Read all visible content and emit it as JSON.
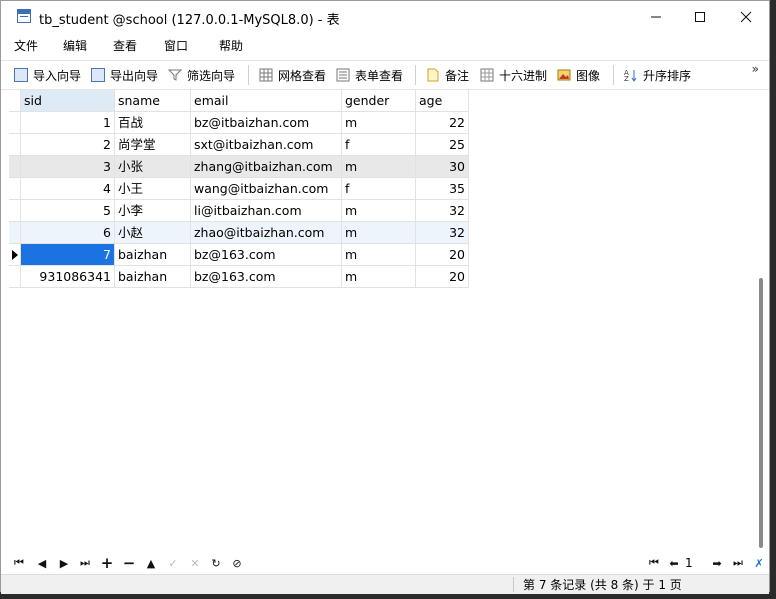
{
  "window": {
    "title": "tb_student @school (127.0.0.1-MySQL8.0) - 表"
  },
  "menu": [
    "文件",
    "编辑",
    "查看",
    "窗口",
    "帮助"
  ],
  "toolbar": {
    "import_wizard": "导入向导",
    "export_wizard": "导出向导",
    "filter_wizard": "筛选向导",
    "grid_view": "网格查看",
    "form_view": "表单查看",
    "memo": "备注",
    "hex": "十六进制",
    "image": "图像",
    "sort_ascending": "升序排序"
  },
  "table": {
    "columns": [
      "sid",
      "sname",
      "email",
      "gender",
      "age"
    ],
    "rows": [
      [
        "1",
        "百战",
        "bz@itbaizhan.com",
        "m",
        "22"
      ],
      [
        "2",
        "尚学堂",
        "sxt@itbaizhan.com",
        "f",
        "25"
      ],
      [
        "3",
        "小张",
        "zhang@itbaizhan.com",
        "m",
        "30"
      ],
      [
        "4",
        "小王",
        "wang@itbaizhan.com",
        "f",
        "35"
      ],
      [
        "5",
        "小李",
        "li@itbaizhan.com",
        "m",
        "32"
      ],
      [
        "6",
        "小赵",
        "zhao@itbaizhan.com",
        "m",
        "32"
      ],
      [
        "7",
        "baizhan",
        "bz@163.com",
        "m",
        "20"
      ],
      [
        "931086341",
        "baizhan",
        "bz@163.com",
        "m",
        "20"
      ]
    ],
    "selected_row_index": 6
  },
  "navigator": {
    "page": "1"
  },
  "status": {
    "record_text": "第 7 条记录 (共 8 条) 于 1 页"
  },
  "colors": {
    "selected_cell": "#1a73e0",
    "header_highlight": "#dfeaf7",
    "row_hover": "#e8e8e8",
    "row_alt": "#eef4fc"
  }
}
